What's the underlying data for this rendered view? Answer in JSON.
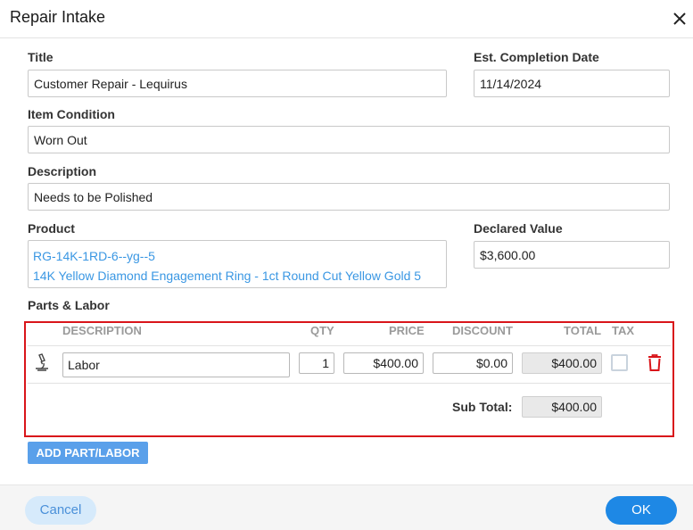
{
  "dialog": {
    "title": "Repair Intake"
  },
  "form": {
    "title_label": "Title",
    "title_value": "Customer Repair - Lequirus",
    "completion_label": "Est. Completion Date",
    "completion_value": "11/14/2024",
    "condition_label": "Item Condition",
    "condition_value": "Worn Out",
    "description_label": "Description",
    "description_value": "Needs to be Polished",
    "product_label": "Product",
    "product_sku": "RG-14K-1RD-6--yg--5",
    "product_name": "14K Yellow Diamond Engagement Ring - 1ct Round Cut Yellow Gold 5",
    "declared_label": "Declared Value",
    "declared_value": "$3,600.00"
  },
  "parts": {
    "section_label": "Parts & Labor",
    "columns": {
      "description": "DESCRIPTION",
      "qty": "QTY",
      "price": "PRICE",
      "discount": "DISCOUNT",
      "total": "TOTAL",
      "tax": "TAX"
    },
    "rows": [
      {
        "icon": "microscope-icon",
        "description": "Labor",
        "qty": "1",
        "price": "$400.00",
        "discount": "$0.00",
        "total": "$400.00",
        "tax": false
      }
    ],
    "subtotal_label": "Sub Total:",
    "subtotal_value": "$400.00",
    "highlight_color": "#d9151a"
  },
  "actions": {
    "add_label": "ADD PART/LABOR",
    "cancel_label": "Cancel",
    "ok_label": "OK"
  },
  "colors": {
    "accent": "#1e88e5",
    "link": "#3a97e3",
    "delete": "#d9151a"
  }
}
